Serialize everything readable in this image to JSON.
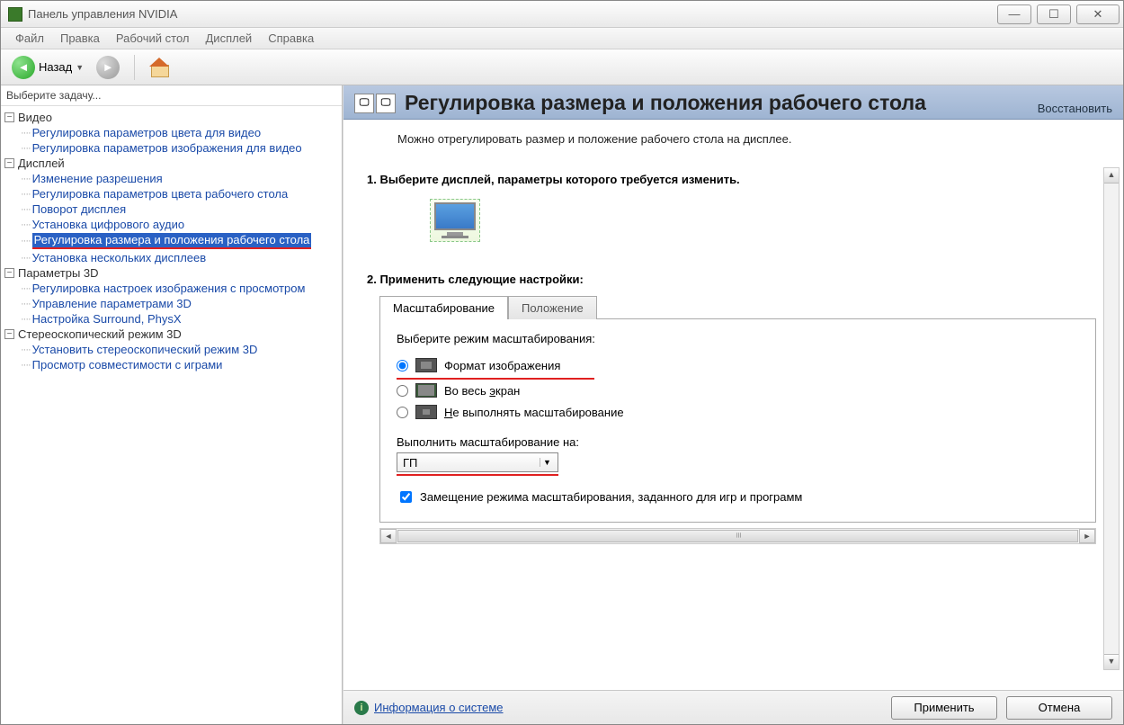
{
  "window": {
    "title": "Панель управления NVIDIA"
  },
  "menu": {
    "file": "Файл",
    "edit": "Правка",
    "desktop": "Рабочий стол",
    "display": "Дисплей",
    "help": "Справка"
  },
  "toolbar": {
    "back": "Назад"
  },
  "sidebar": {
    "task_label": "Выберите задачу...",
    "groups": [
      {
        "label": "Видео",
        "items": [
          "Регулировка параметров цвета для видео",
          "Регулировка параметров изображения для видео"
        ]
      },
      {
        "label": "Дисплей",
        "items": [
          "Изменение разрешения",
          "Регулировка параметров цвета рабочего стола",
          "Поворот дисплея",
          "Установка цифрового аудио",
          "Регулировка размера и положения рабочего стола",
          "Установка нескольких дисплеев"
        ],
        "selected_index": 4
      },
      {
        "label": "Параметры 3D",
        "items": [
          "Регулировка настроек изображения с просмотром",
          "Управление параметрами 3D",
          "Настройка Surround, PhysX"
        ]
      },
      {
        "label": "Стереоскопический режим 3D",
        "items": [
          "Установить стереоскопический режим 3D",
          "Просмотр совместимости с играми"
        ]
      }
    ]
  },
  "main": {
    "title": "Регулировка размера и положения рабочего стола",
    "restore": "Восстановить",
    "desc": "Можно отрегулировать размер и положение рабочего стола на дисплее.",
    "step1": "1. Выберите дисплей, параметры которого требуется изменить.",
    "step2": "2. Применить следующие настройки:",
    "tabs": {
      "scaling": "Масштабирование",
      "position": "Положение"
    },
    "scale_mode_label": "Выберите режим масштабирования:",
    "radios": {
      "aspect": "Формат изображения",
      "full": "Во весь экран",
      "none": "Не выполнять масштабирование"
    },
    "perform_on_label": "Выполнить масштабирование на:",
    "perform_on_value": "ГП",
    "override": "Замещение режима масштабирования, заданного для игр и программ"
  },
  "footer": {
    "sysinfo": "Информация о системе",
    "apply": "Применить",
    "cancel": "Отмена"
  }
}
